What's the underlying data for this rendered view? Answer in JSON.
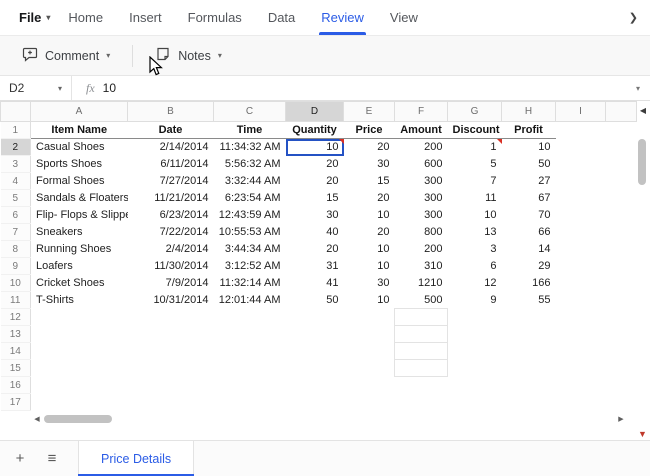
{
  "colors": {
    "accent": "#2b5ce6",
    "selection_border": "#2452c4",
    "note_marker": "#d93025"
  },
  "icons": {
    "chevron_down": "▾",
    "menu_overflow": "❯",
    "scroll_left": "◀",
    "scroll_right": "▶",
    "scroll_back": "◀",
    "scroll_down_red": "▼",
    "add_sheet": "+",
    "sheet_list": "≡"
  },
  "menu": {
    "items": [
      {
        "label": "File",
        "has_chevron": true,
        "active": false
      },
      {
        "label": "Home",
        "active": false
      },
      {
        "label": "Insert",
        "active": false
      },
      {
        "label": "Formulas",
        "active": false
      },
      {
        "label": "Data",
        "active": false
      },
      {
        "label": "Review",
        "active": true
      },
      {
        "label": "View",
        "active": false
      }
    ]
  },
  "toolbar": {
    "comment_label": "Comment",
    "notes_label": "Notes"
  },
  "formula_bar": {
    "cell_ref": "D2",
    "fx_label": "fx",
    "value": "10"
  },
  "grid": {
    "columns": [
      "A",
      "B",
      "C",
      "D",
      "E",
      "F",
      "G",
      "H",
      "I",
      ""
    ],
    "selected_column": "D",
    "selected_row": 2,
    "visible_rows": 17,
    "headers": [
      "Item Name",
      "Date",
      "Time",
      "Quantity",
      "Price",
      "Amount",
      "Discount",
      "Profit"
    ],
    "rows": [
      [
        "Casual Shoes",
        "2/14/2014",
        "11:34:32 AM",
        "10",
        "20",
        "200",
        "1",
        "10"
      ],
      [
        "Sports Shoes",
        "6/11/2014",
        "5:56:32 AM",
        "20",
        "30",
        "600",
        "5",
        "50"
      ],
      [
        "Formal Shoes",
        "7/27/2014",
        "3:32:44 AM",
        "20",
        "15",
        "300",
        "7",
        "27"
      ],
      [
        "Sandals & Floaters",
        "11/21/2014",
        "6:23:54 AM",
        "15",
        "20",
        "300",
        "11",
        "67"
      ],
      [
        "Flip- Flops & Slippers",
        "6/23/2014",
        "12:43:59 AM",
        "30",
        "10",
        "300",
        "10",
        "70"
      ],
      [
        "Sneakers",
        "7/22/2014",
        "10:55:53 AM",
        "40",
        "20",
        "800",
        "13",
        "66"
      ],
      [
        "Running Shoes",
        "2/4/2014",
        "3:44:34 AM",
        "20",
        "10",
        "200",
        "3",
        "14"
      ],
      [
        "Loafers",
        "11/30/2014",
        "3:12:52 AM",
        "31",
        "10",
        "310",
        "6",
        "29"
      ],
      [
        "Cricket Shoes",
        "7/9/2014",
        "11:32:14 AM",
        "41",
        "30",
        "1210",
        "12",
        "166"
      ],
      [
        "T-Shirts",
        "10/31/2014",
        "12:01:44 AM",
        "50",
        "10",
        "500",
        "9",
        "55"
      ]
    ],
    "note_cells": [
      {
        "col": "D",
        "row": 2
      },
      {
        "col": "G",
        "row": 2
      }
    ],
    "bordered_range": {
      "col": "F",
      "rows": [
        12,
        15
      ]
    }
  },
  "sheet_bar": {
    "tab_label": "Price Details"
  }
}
